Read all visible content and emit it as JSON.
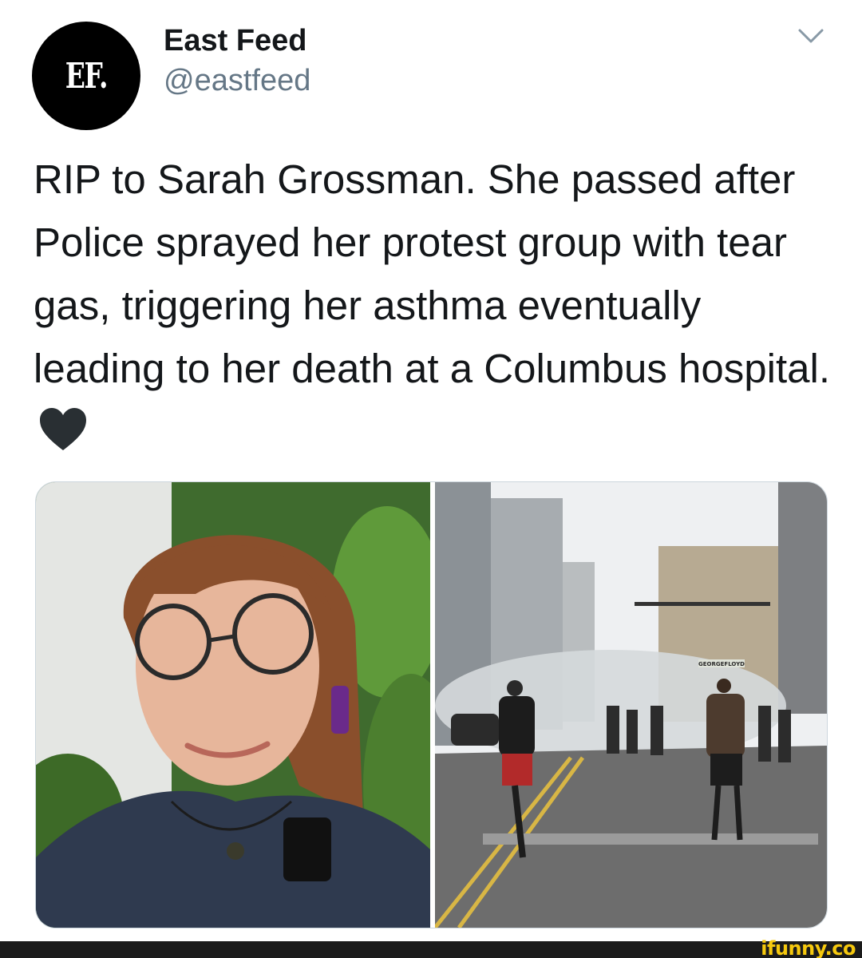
{
  "tweet": {
    "avatar_text": "EF.",
    "display_name": "East Feed",
    "handle": "@eastfeed",
    "text": "RIP to Sarah Grossman. She passed after Police sprayed her protest group with tear gas, triggering her asthma eventually leading to her death at a Columbus hospital.",
    "icons": {
      "menu": "chevron-down-icon",
      "emoji": "black-heart-icon"
    }
  },
  "media": {
    "left_photo": "portrait-photo",
    "right_photo": "protest-street-photo",
    "street_sign_text": "GEORGEFLOYD"
  },
  "watermark": {
    "text": "ifunny.co"
  },
  "colors": {
    "text": "#14171a",
    "secondary_text": "#657786",
    "border": "#ccd6dd",
    "watermark": "#f6c90e"
  }
}
